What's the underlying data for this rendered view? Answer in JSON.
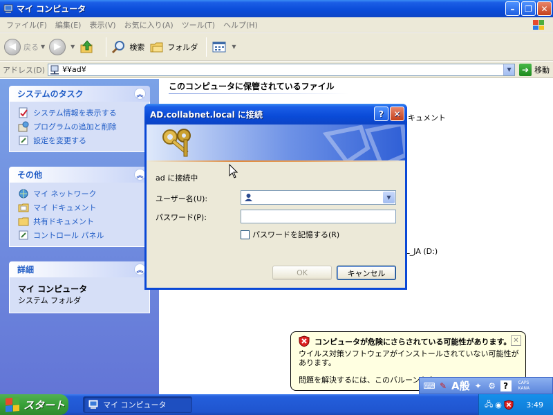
{
  "window": {
    "title": "マイ コンピュータ"
  },
  "menu": [
    "ファイル(F)",
    "編集(E)",
    "表示(V)",
    "お気に入り(A)",
    "ツール(T)",
    "ヘルプ(H)"
  ],
  "toolbar": {
    "back": "戻る",
    "search": "検索",
    "folders": "フォルダ"
  },
  "address": {
    "label": "アドレス(D)",
    "value": "¥¥ad¥",
    "go": "移動"
  },
  "left_panel": {
    "system_tasks": {
      "title": "システムのタスク",
      "items": [
        "システム情報を表示する",
        "プログラムの追加と削除",
        "設定を変更する"
      ]
    },
    "other_places": {
      "title": "その他",
      "items": [
        "マイ ネットワーク",
        "マイ ドキュメント",
        "共有ドキュメント",
        "コントロール パネル"
      ]
    },
    "details": {
      "title": "詳細",
      "name": "マイ コンピュータ",
      "type": "システム フォルダ"
    }
  },
  "main": {
    "section_header": "このコンピュータに保管されているファイル",
    "partial_docs": "キュメント",
    "partial_drive": "OL_JA (D:)"
  },
  "dialog": {
    "title": "AD.collabnet.local に接続",
    "connecting": "ad に接続中",
    "username_label": "ユーザー名(U):",
    "username_value": "",
    "password_label": "パスワード(P):",
    "password_value": "",
    "remember_label": "パスワードを記憶する(R)",
    "ok": "OK",
    "cancel": "キャンセル"
  },
  "balloon": {
    "title": "コンピュータが危険にさらされている可能性があります。",
    "message": "ウイルス対策ソフトウェアがインストールされていない可能性があります。",
    "message2": "問題を解決するには、このバルーンをク"
  },
  "langbar": {
    "ime": "A般",
    "caps": "CAPS",
    "kana": "KANA"
  },
  "taskbar": {
    "start": "スタート",
    "task": "マイ コンピュータ",
    "clock": "3:49"
  },
  "colors": {
    "xp_blue": "#0a4bd8",
    "panel_blue": "#7ba2e7",
    "link_blue": "#215dc6",
    "balloon": "#ffffe1"
  }
}
